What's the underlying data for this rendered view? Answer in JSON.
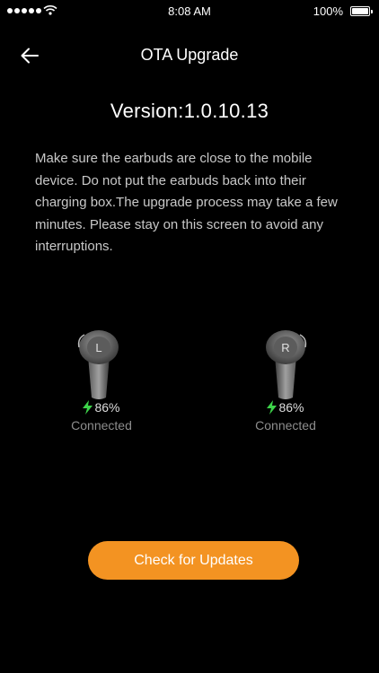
{
  "status_bar": {
    "time": "8:08 AM",
    "battery_percent": "100%",
    "signal_icon": "signal-dots-icon",
    "wifi_icon": "wifi-icon",
    "battery_icon": "battery-icon"
  },
  "nav": {
    "title": "OTA Upgrade",
    "back_icon": "back-arrow-icon"
  },
  "version_text": "Version:1.0.10.13",
  "notice": "Make sure the earbuds are close to the mobile device. Do not put the earbuds back into their charging box.The upgrade process may take a few minutes. Please stay on this screen to avoid any interruptions.",
  "earbuds": {
    "left": {
      "letter": "L",
      "battery": "86%",
      "status": "Connected"
    },
    "right": {
      "letter": "R",
      "battery": "86%",
      "status": "Connected"
    }
  },
  "check_button_label": "Check for Updates",
  "colors": {
    "accent": "#f39322",
    "battery_bolt": "#3dd34a",
    "background": "#000000"
  }
}
